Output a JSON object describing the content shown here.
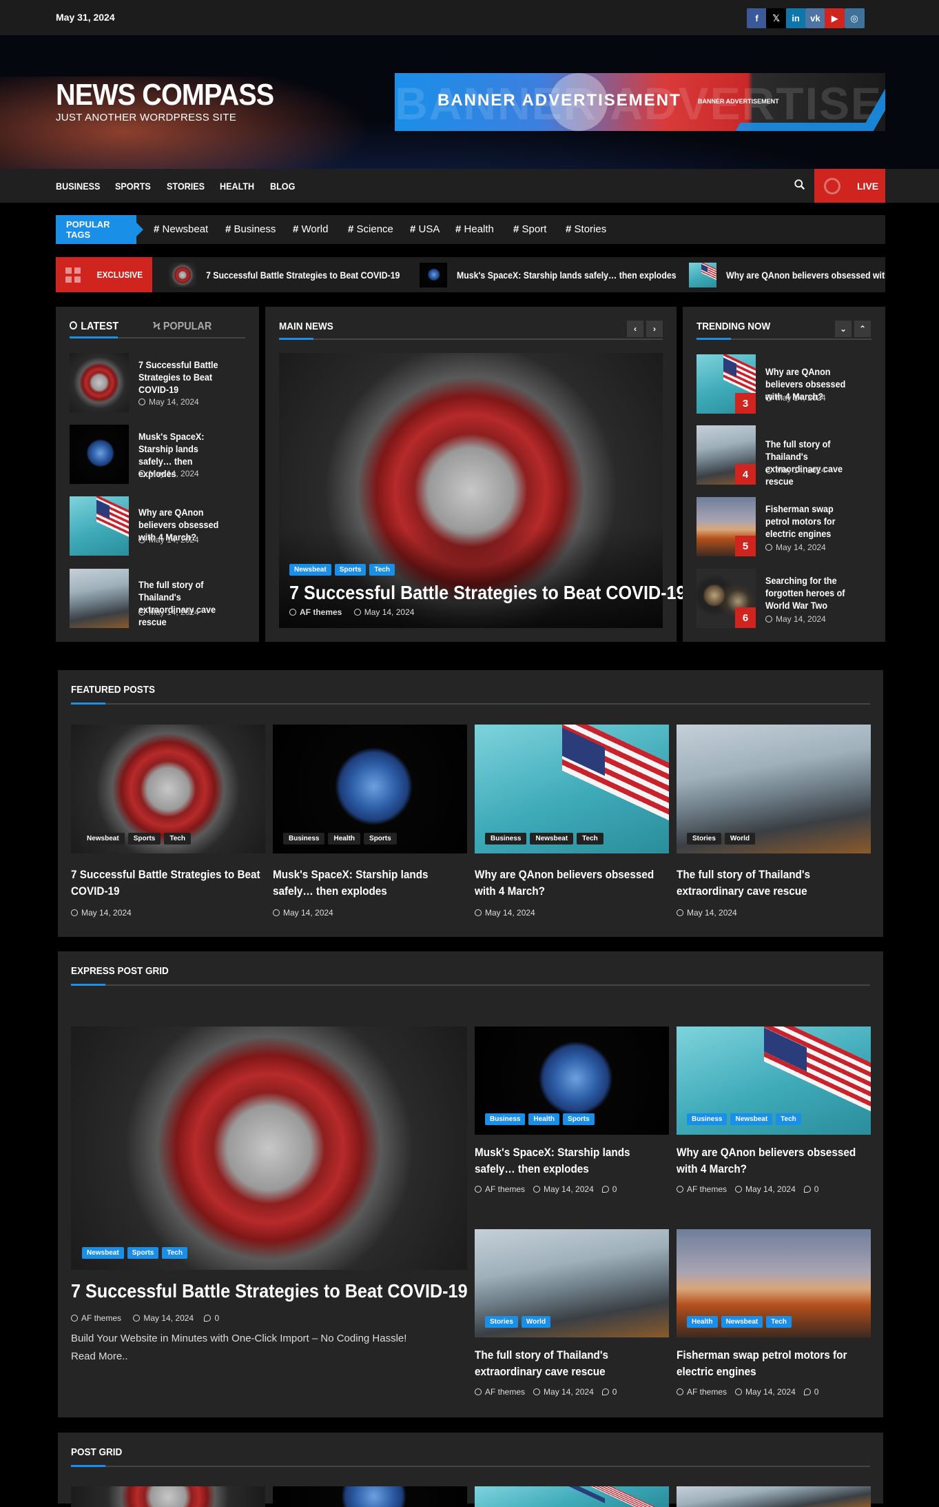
{
  "topbar": {
    "date": "May 31, 2024",
    "social": [
      {
        "icon": "facebook-icon",
        "glyph": "f",
        "color": "#3b5998"
      },
      {
        "icon": "x-twitter-icon",
        "glyph": "𝕏",
        "color": "#000000"
      },
      {
        "icon": "linkedin-icon",
        "glyph": "in",
        "color": "#0e76a8"
      },
      {
        "icon": "vk-icon",
        "glyph": "vk",
        "color": "#4c75a3"
      },
      {
        "icon": "youtube-icon",
        "glyph": "▶",
        "color": "#d0241f"
      },
      {
        "icon": "instagram-icon",
        "glyph": "◎",
        "color": "#3f729b"
      }
    ]
  },
  "header": {
    "site_name": "NEWS COMPASS",
    "tagline": "JUST ANOTHER WORDPRESS SITE",
    "banner": {
      "main": "BANNER ADVERTISEMENT",
      "ghost": "BANNER ADVERTISEMENT",
      "small": "BANNER ADVERTISEMENT"
    }
  },
  "nav": {
    "items": [
      "BUSINESS",
      "SPORTS",
      "STORIES",
      "HEALTH",
      "BLOG"
    ],
    "live_label": "LIVE"
  },
  "popular_tags": {
    "label": "POPULAR TAGS",
    "tags": [
      "Newsbeat",
      "Business",
      "World",
      "Science",
      "USA",
      "Health",
      "Sport",
      "Stories"
    ]
  },
  "exclusive": {
    "label": "EXCLUSIVE",
    "items": [
      "7 Successful Battle Strategies to Beat COVID-19",
      "Musk's SpaceX: Starship lands safely… then explodes",
      "Why are QAnon believers obsessed with 4 March?"
    ]
  },
  "latest": {
    "tab_latest": "LATEST",
    "tab_popular": "POPULAR",
    "items": [
      {
        "title": "7 Successful Battle Strategies to Beat COVID-19",
        "date": "May 14, 2024"
      },
      {
        "title": "Musk's SpaceX: Starship lands safely… then explodes",
        "date": "May 14, 2024"
      },
      {
        "title": "Why are QAnon believers obsessed with 4 March?",
        "date": "May 14, 2024"
      },
      {
        "title": "The full story of Thailand's extraordinary cave rescue",
        "date": "May 14, 2024"
      }
    ]
  },
  "main_news": {
    "title": "MAIN NEWS",
    "categories": [
      "Newsbeat",
      "Sports",
      "Tech"
    ],
    "headline": "7 Successful Battle Strategies to Beat COVID-19",
    "author": "AF themes",
    "date": "May 14, 2024"
  },
  "trending": {
    "title": "TRENDING NOW",
    "items": [
      {
        "num": "3",
        "title": "Why are QAnon believers obsessed with 4 March?",
        "date": "May 14, 2024"
      },
      {
        "num": "4",
        "title": "The full story of Thailand's extraordinary cave rescue",
        "date": "May 14, 2024"
      },
      {
        "num": "5",
        "title": "Fisherman swap petrol motors for electric engines",
        "date": "May 14, 2024"
      },
      {
        "num": "6",
        "title": "Searching for the forgotten heroes of World War Two",
        "date": "May 14, 2024"
      }
    ]
  },
  "featured": {
    "title": "FEATURED POSTS",
    "cards": [
      {
        "cats": [
          "Newsbeat",
          "Sports",
          "Tech"
        ],
        "title": "7 Successful Battle Strategies to Beat COVID-19",
        "date": "May 14, 2024"
      },
      {
        "cats": [
          "Business",
          "Health",
          "Sports"
        ],
        "title": "Musk's SpaceX: Starship lands safely… then explodes",
        "date": "May 14, 2024"
      },
      {
        "cats": [
          "Business",
          "Newsbeat",
          "Tech"
        ],
        "title": "Why are QAnon believers obsessed with 4 March?",
        "date": "May 14, 2024"
      },
      {
        "cats": [
          "Stories",
          "World"
        ],
        "title": "The full story of Thailand's extraordinary cave rescue",
        "date": "May 14, 2024"
      }
    ]
  },
  "express": {
    "title": "EXPRESS POST GRID",
    "main": {
      "cats": [
        "Newsbeat",
        "Sports",
        "Tech"
      ],
      "title": "7 Successful Battle Strategies to Beat COVID-19",
      "author": "AF themes",
      "date": "May 14, 2024",
      "comments": "0",
      "excerpt": "Build Your Website in Minutes with One-Click Import – No Coding Hassle!",
      "read_more": "Read More.."
    },
    "cards": [
      {
        "cats": [
          "Business",
          "Health",
          "Sports"
        ],
        "title": "Musk's SpaceX: Starship lands safely… then explodes",
        "author": "AF themes",
        "date": "May 14, 2024",
        "comments": "0"
      },
      {
        "cats": [
          "Business",
          "Newsbeat",
          "Tech"
        ],
        "title": "Why are QAnon believers obsessed with 4 March?",
        "author": "AF themes",
        "date": "May 14, 2024",
        "comments": "0"
      },
      {
        "cats": [
          "Stories",
          "World"
        ],
        "title": "The full story of Thailand's extraordinary cave rescue",
        "author": "AF themes",
        "date": "May 14, 2024",
        "comments": "0"
      },
      {
        "cats": [
          "Health",
          "Newsbeat",
          "Tech"
        ],
        "title": "Fisherman swap petrol motors for electric engines",
        "author": "AF themes",
        "date": "May 14, 2024",
        "comments": "0"
      }
    ]
  },
  "post_grid": {
    "title": "POST GRID"
  }
}
